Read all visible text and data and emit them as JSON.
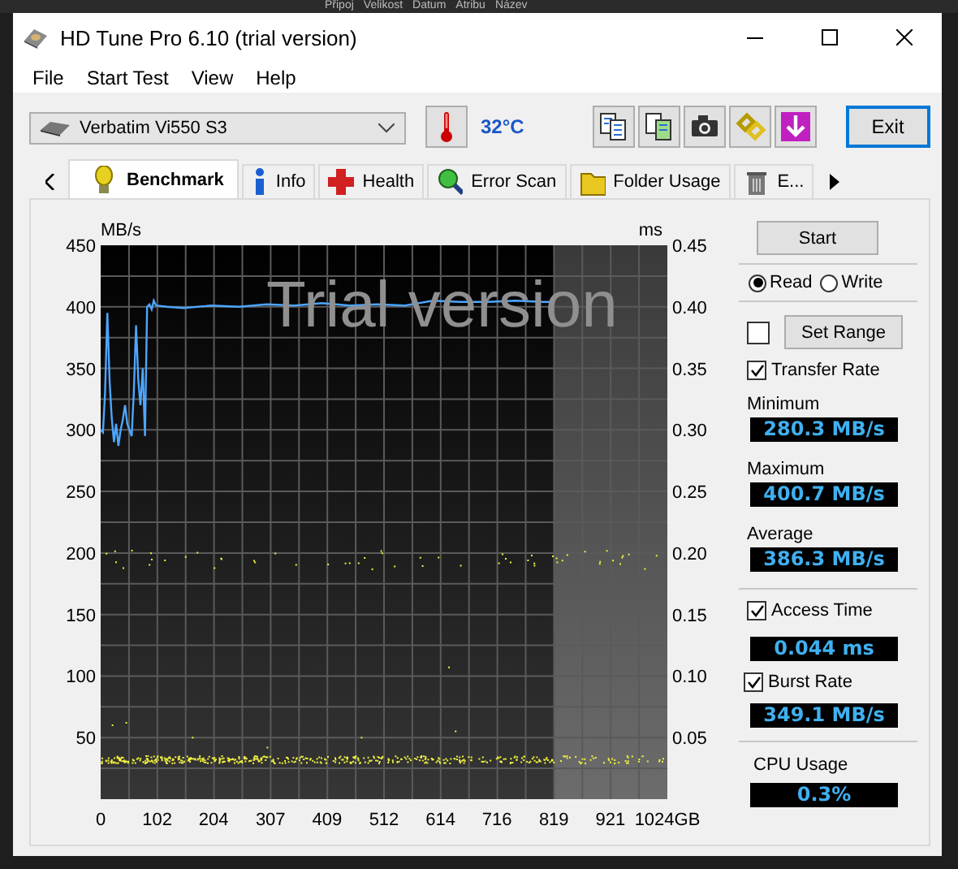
{
  "background_window": {
    "columns": [
      "Připoj",
      "Velikost",
      "Datum",
      "Atribu",
      "Název"
    ]
  },
  "window": {
    "title": "HD Tune Pro 6.10 (trial version)"
  },
  "menu": [
    "File",
    "Start Test",
    "View",
    "Help"
  ],
  "toolbar": {
    "drive_select": {
      "value": "Verbatim Vi550 S3"
    },
    "temperature": "32°C",
    "exit_button": "Exit"
  },
  "tabs": [
    {
      "label": "Benchmark",
      "selected": true
    },
    {
      "label": "Info",
      "selected": false
    },
    {
      "label": "Health",
      "selected": false
    },
    {
      "label": "Error Scan",
      "selected": false
    },
    {
      "label": "Folder Usage",
      "selected": false
    },
    {
      "label": "E...",
      "selected": false
    }
  ],
  "chart": {
    "watermark": "Trial version",
    "ms_axis": {
      "label": "ms",
      "ticks": [
        "0.45",
        "0.40",
        "0.35",
        "0.30",
        "0.25",
        "0.20",
        "0.15",
        "0.10",
        "0.05"
      ]
    },
    "chart_data": {
      "type": "line",
      "ylabel": "MB/s",
      "grid": true,
      "xlim": [
        0,
        1024
      ],
      "ylim": [
        0,
        450
      ],
      "xticks": [
        0,
        102,
        204,
        307,
        409,
        512,
        614,
        716,
        819,
        921,
        {
          "value": 1024,
          "label": "1024GB"
        }
      ],
      "yticks": [
        50,
        100,
        150,
        200,
        250,
        300,
        350,
        400,
        450
      ],
      "x": [
        0,
        4,
        8,
        12,
        16,
        20,
        24,
        28,
        32,
        36,
        40,
        44,
        48,
        52,
        56,
        60,
        64,
        68,
        72,
        76,
        80,
        84,
        88,
        92,
        96,
        100,
        120,
        150,
        200,
        250,
        300,
        350,
        400,
        450,
        500,
        550,
        600,
        650,
        700,
        750,
        800,
        815
      ],
      "series": [
        {
          "color": "#4da6ff",
          "values": [
            300,
            298,
            330,
            395,
            340,
            310,
            290,
            305,
            287,
            300,
            308,
            320,
            305,
            300,
            295,
            330,
            385,
            340,
            320,
            350,
            295,
            400,
            402,
            398,
            405,
            401,
            400,
            399,
            401,
            400,
            402,
            401,
            403,
            401,
            402,
            401,
            405,
            404,
            404,
            405,
            404,
            404
          ]
        }
      ]
    }
  },
  "side": {
    "start_button": "Start",
    "modes": [
      {
        "label": "Read",
        "selected": true
      },
      {
        "label": "Write",
        "selected": false
      }
    ],
    "range": {
      "checked": false,
      "button": "Set Range"
    },
    "transfer_rate": {
      "label": "Transfer Rate",
      "checked": true
    },
    "stats": [
      {
        "label": "Minimum",
        "value": "280.3 MB/s"
      },
      {
        "label": "Maximum",
        "value": "400.7 MB/s"
      },
      {
        "label": "Average",
        "value": "386.3 MB/s"
      }
    ],
    "access_time": {
      "label": "Access Time",
      "checked": true,
      "value": "0.044 ms"
    },
    "burst_rate": {
      "label": "Burst Rate",
      "checked": true,
      "value": "349.1 MB/s"
    },
    "cpu": {
      "label": "CPU Usage",
      "value": "0.3%"
    }
  }
}
